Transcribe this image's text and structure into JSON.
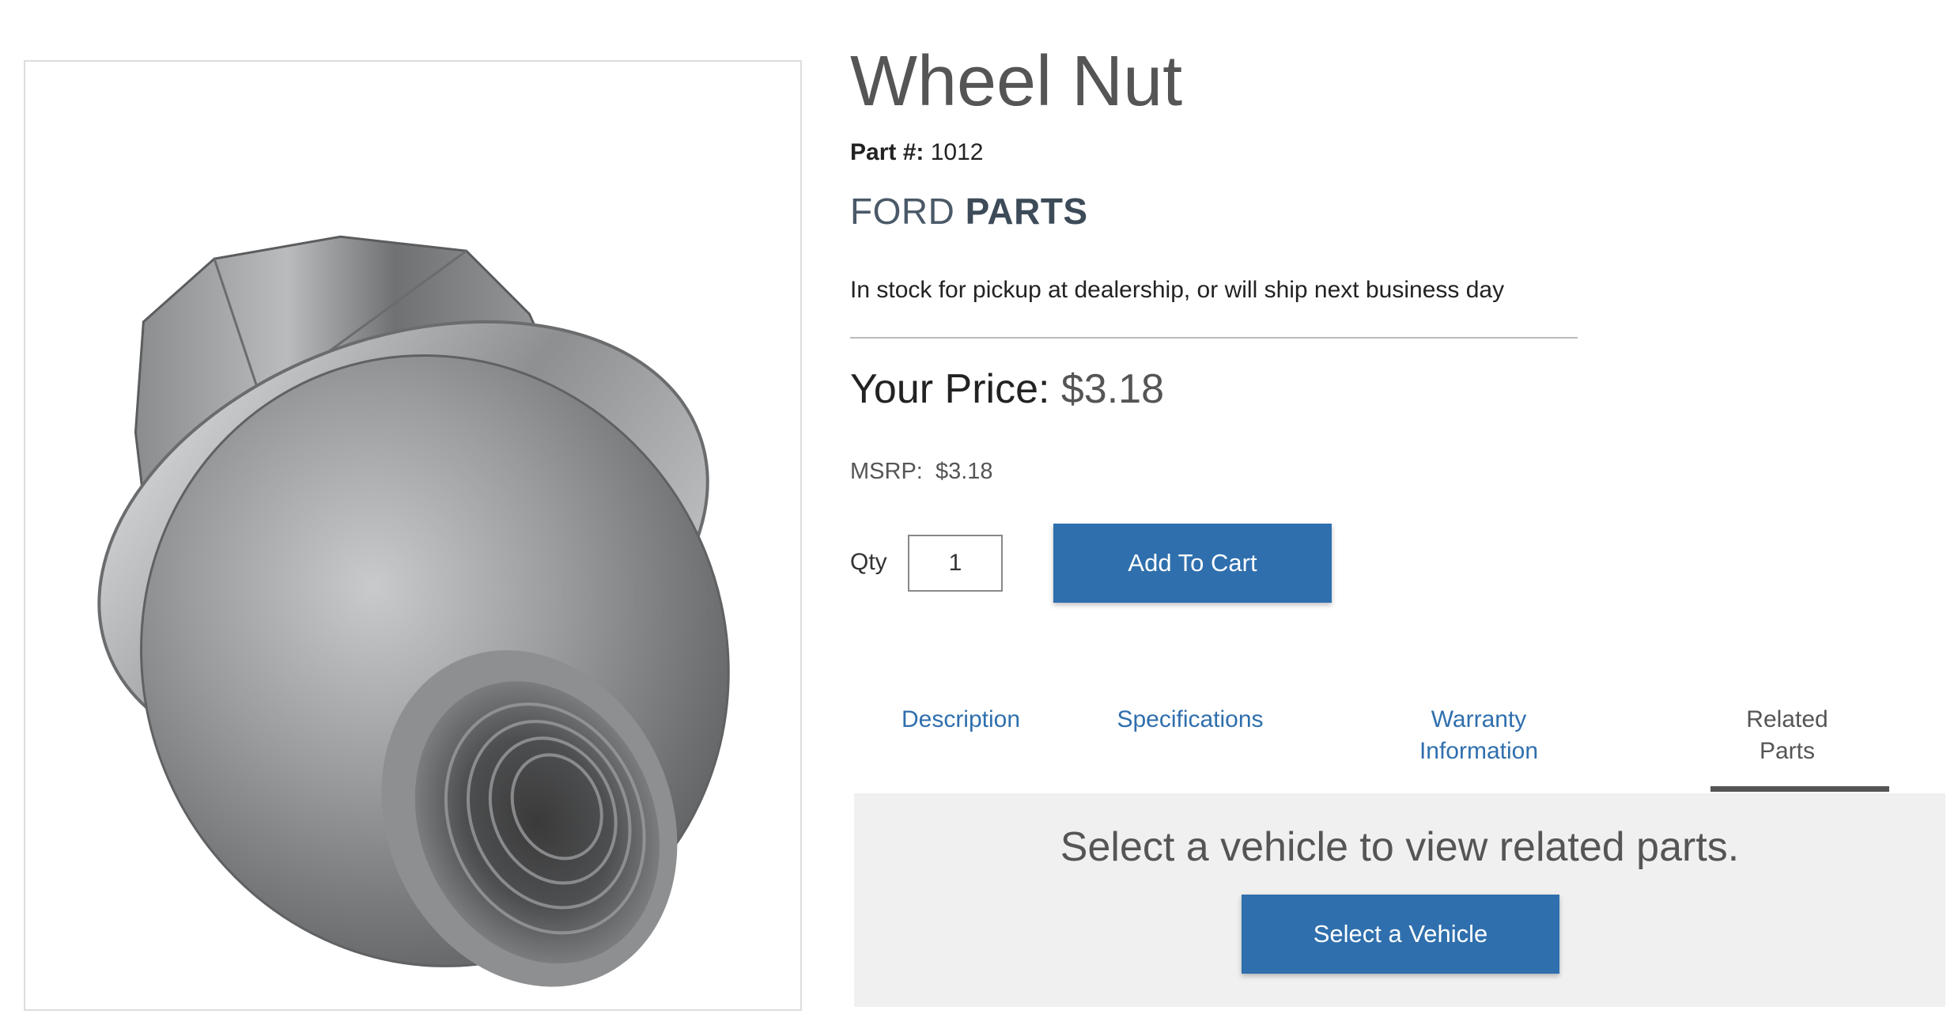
{
  "product": {
    "title": "Wheel Nut",
    "part_label": "Part #:",
    "part_number": "1012",
    "brand_light": "FORD",
    "brand_bold": "PARTS",
    "stock_text": "In stock for pickup at dealership, or will ship next business day"
  },
  "pricing": {
    "your_price_label": "Your Price:",
    "your_price": "$3.18",
    "msrp_label": "MSRP:",
    "msrp": "$3.18"
  },
  "cart": {
    "qty_label": "Qty",
    "qty_value": "1",
    "add_to_cart_label": "Add To Cart"
  },
  "tabs": [
    {
      "line1": "Description",
      "line2": ""
    },
    {
      "line1": "Specifications",
      "line2": ""
    },
    {
      "line1": "Warranty",
      "line2": "Information"
    },
    {
      "line1": "Related",
      "line2": "Parts"
    }
  ],
  "active_tab": "Related Parts",
  "related_panel": {
    "message": "Select a vehicle to view related parts.",
    "button_label": "Select a Vehicle"
  },
  "colors": {
    "accent": "#2f6fad",
    "panel_bg": "#f0f0f0",
    "brand": "#4a5968"
  },
  "image": {
    "alt_subject": "wheel-nut-photo"
  }
}
